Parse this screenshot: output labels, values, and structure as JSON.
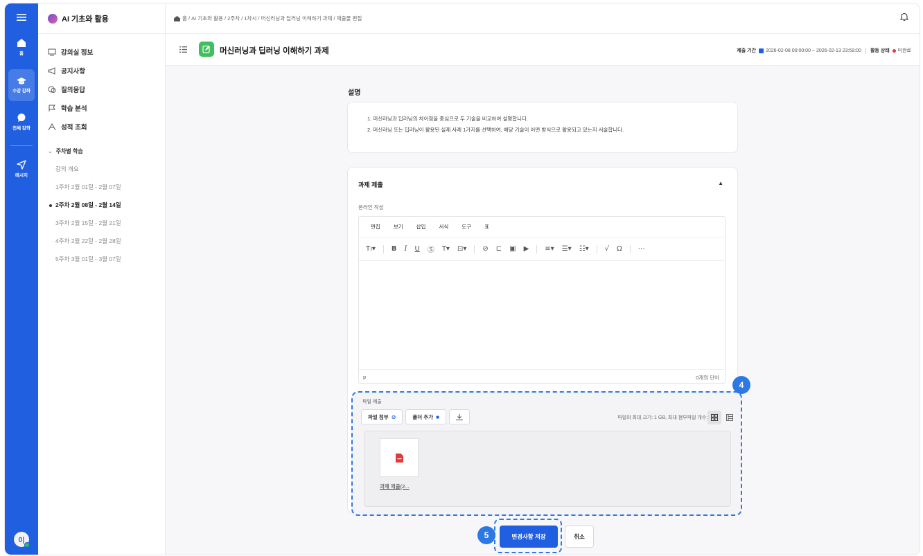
{
  "rail": {
    "items": [
      {
        "label": "홈",
        "icon": "home-icon"
      },
      {
        "label": "수강 강좌",
        "icon": "graduation-cap-icon"
      },
      {
        "label": "전체 강좌",
        "icon": "chat-bubble-icon"
      },
      {
        "label": "메시지",
        "icon": "send-icon"
      }
    ],
    "avatar": "이",
    "accent": "#1f5fe0"
  },
  "course": {
    "title": "AI 기초와 활용",
    "menu": [
      {
        "label": "강의실 정보",
        "icon": "classroom-icon"
      },
      {
        "label": "공지사항",
        "icon": "megaphone-icon"
      },
      {
        "label": "질의응답",
        "icon": "speech-bubbles-icon"
      },
      {
        "label": "학습 분석",
        "icon": "flag-icon"
      },
      {
        "label": "성적 조회",
        "icon": "grade-icon"
      }
    ],
    "week_section": "주차별 학습",
    "weeks": [
      "강의 개요",
      "1주차 2월 01일 - 2월 07일",
      "2주차 2월 08일 - 2월 14일",
      "3주차 2월 15일 - 2월 21일",
      "4주차 2월 22일 - 2월 28일",
      "5주차 3월 01일 - 3월 07일"
    ]
  },
  "topbar": {
    "breadcrumb": "홈 / AI 기초와 활용 / 2주차 / 1차시 / 머신러닝과 딥러닝 이해하기 과제 / 제출물 편집"
  },
  "titlebar": {
    "title": "머신러닝과 딥러닝 이해하기 과제",
    "period_label": "제출 기간",
    "period_value": "2026-02-08 00:00:00 ~ 2026-02-13 23:59:00",
    "status_label": "활동 상태",
    "status_value": "미완료",
    "status_color": "#e23b3b"
  },
  "description": {
    "label": "설명",
    "lines": [
      "1. 머신러닝과 딥러닝의 차이점을 중심으로 두 기술을 비교하여 설명합니다.",
      "2. 머신러닝 또는 딥러닝이 활용된 실제 사례 1가지를 선택하여, 해당 기술이 어떤 방식으로 활용되고 있는지 서술합니다."
    ]
  },
  "submission": {
    "title": "과제 제출",
    "online_label": "온라인 작성",
    "editor": {
      "menus": [
        "편집",
        "보기",
        "삽입",
        "서식",
        "도구",
        "표"
      ],
      "status_left": "p",
      "status_right": "0개의 단어"
    },
    "files": {
      "label": "파일 제출",
      "attach_label": "파일 첨부",
      "folder_label": "폴더 추가",
      "limit_text": "파일의 최대 크기: 1 GB, 최대 첨부파일 개수: 20",
      "file_name": "과제 제출(2..."
    }
  },
  "actions": {
    "save_label": "변경사항 저장",
    "cancel_label": "취소"
  },
  "badges": {
    "file_step": "4",
    "save_step": "5"
  }
}
